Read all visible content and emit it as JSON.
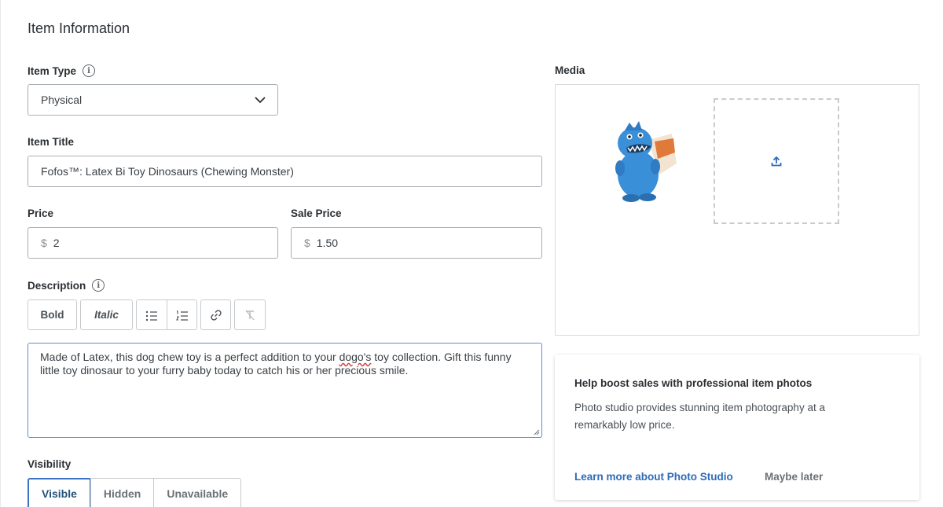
{
  "section": {
    "title": "Item Information"
  },
  "item_type": {
    "label": "Item Type",
    "value": "Physical"
  },
  "item_title": {
    "label": "Item Title",
    "value": "Fofos™: Latex Bi Toy Dinosaurs (Chewing Monster)"
  },
  "price": {
    "label": "Price",
    "currency": "$",
    "value": "2"
  },
  "sale_price": {
    "label": "Sale Price",
    "currency": "$",
    "value": "1.50"
  },
  "description": {
    "label": "Description",
    "toolbar": {
      "bold": "Bold",
      "italic": "Italic"
    },
    "text_before": "Made of Latex, this dog chew toy is a perfect addition to your ",
    "misspelled": "dogo's",
    "text_after": " toy collection. Gift this funny little toy dinosaur to your furry baby today to catch his or her precious smile."
  },
  "visibility": {
    "label": "Visibility",
    "options": [
      "Visible",
      "Hidden",
      "Unavailable"
    ],
    "selected": "Visible"
  },
  "media": {
    "label": "Media"
  },
  "promo": {
    "title": "Help boost sales with professional item photos",
    "text": "Photo studio provides stunning item photography at a remarkably low price.",
    "link": "Learn more about Photo Studio",
    "dismiss": "Maybe later"
  },
  "colors": {
    "accent": "#2e6bb8",
    "focus_border": "#5b8fd6",
    "dino_blue": "#3a8fd9"
  }
}
